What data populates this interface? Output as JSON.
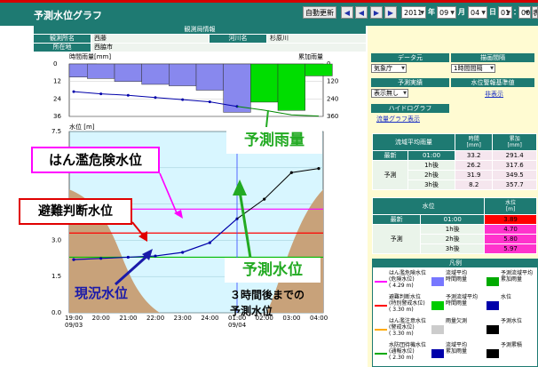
{
  "app_title": "予測水位グラフ",
  "toolbar": {
    "auto_update": "自動更新",
    "year": "2011",
    "year_unit": "年",
    "month": "09",
    "month_unit": "月",
    "day": "04",
    "day_unit": "日",
    "hour": "01",
    "hour_unit": "：",
    "minute": "00",
    "display": "表示"
  },
  "station_info": {
    "header": "観測局情報",
    "station_label": "観測所名",
    "station_value": "西藤",
    "river_label": "河川名",
    "river_value": "杉原川",
    "location_label": "所在地",
    "location_value": "西脇市"
  },
  "side_panel": {
    "data_source_label": "データ元",
    "data_source_value": "気象庁",
    "interval_label": "描画間隔",
    "interval_value": "1時間間隔",
    "forecast_label": "予測実績",
    "forecast_value": "表示無し",
    "warning_label": "水位警報基準値",
    "warning_link": "非表示",
    "hydro_label": "ハイドログラフ",
    "hydro_link": "流量グラフ表示"
  },
  "rain_table": {
    "headers": [
      "流域平均雨量",
      "時間\n[mm]",
      "累加\n[mm]"
    ],
    "rows": [
      {
        "label": "最新",
        "time": "01:00",
        "hourly": "33.2",
        "cumulative": "291.4"
      },
      {
        "label": "予測",
        "time": "1h後",
        "hourly": "26.2",
        "cumulative": "317.6"
      },
      {
        "label": "",
        "time": "2h後",
        "hourly": "31.9",
        "cumulative": "349.5"
      },
      {
        "label": "",
        "time": "3h後",
        "hourly": "8.2",
        "cumulative": "357.7"
      }
    ]
  },
  "level_table": {
    "headers": [
      "水位",
      "水位\n[m]"
    ],
    "rows": [
      {
        "label": "最新",
        "time": "01:00",
        "value": "3.89",
        "color": "#ff0000"
      },
      {
        "label": "予測",
        "time": "1h後",
        "value": "4.70",
        "color": "#ff33cc"
      },
      {
        "label": "",
        "time": "2h後",
        "value": "5.80",
        "color": "#ff33cc"
      },
      {
        "label": "",
        "time": "3h後",
        "value": "5.97",
        "color": "#ff33cc"
      }
    ]
  },
  "legend": {
    "title": "凡例",
    "items": [
      {
        "text": "はん濫危険水位\n(危険水位)\n( 4.29 m)",
        "color": "#ff00ff"
      },
      {
        "text": "流域平均\n時間雨量",
        "color": "#7777ff"
      },
      {
        "text": "予測流域平均\n累加雨量",
        "color": "#00aa00"
      },
      {
        "text": "避難判断水位\n(特別警戒水位)\n( 3.30 m)",
        "color": "#ff0000"
      },
      {
        "text": "予測流域平均\n時間雨量",
        "color": "#00cc00"
      },
      {
        "text": "水位",
        "color": "#0000aa"
      },
      {
        "text": "はん濫注意水位\n(警戒水位)\n( 3.30 m)",
        "color": "#ffaa00"
      },
      {
        "text": "雨量欠測",
        "color": "#cccccc"
      },
      {
        "text": "予測水位",
        "color": "#000000"
      },
      {
        "text": "水防団待機水位\n(通報水位)\n( 2.30 m)",
        "color": "#00aa00"
      },
      {
        "text": "流域平均\n累加雨量",
        "color": "#0000aa"
      },
      {
        "text": "予測累積",
        "color": "#000000"
      }
    ]
  },
  "chart_data": {
    "type": "bar+line",
    "rain": {
      "ylabel_left": "時間雨量[mm]",
      "ylabel_right": "累加雨量",
      "left_ticks": [
        "0",
        "12",
        "24",
        "36"
      ],
      "right_ticks": [
        "0",
        "120",
        "240",
        "360"
      ],
      "hourly_actual": [
        9,
        10,
        12,
        14,
        15,
        18,
        33.2
      ],
      "hourly_forecast": [
        26.2,
        31.9,
        8.2
      ],
      "cumulative_actual": [
        190,
        205,
        215,
        230,
        245,
        260,
        291.4
      ],
      "cumulative_forecast": [
        317.6,
        349.5,
        357.7
      ]
    },
    "level": {
      "ylabel": "水位 [m]",
      "y_ticks": [
        "7.5",
        "6.0",
        "4.5",
        "3.0",
        "1.5",
        "0.0"
      ],
      "ylim": [
        0,
        7.5
      ],
      "x_ticks": [
        "19:00",
        "20:00",
        "21:00",
        "22:00",
        "23:00",
        "24:00",
        "01:00",
        "02:00",
        "03:00",
        "04:00"
      ],
      "date_labels": [
        "09/03",
        "09/04"
      ],
      "actual": [
        2.2,
        2.25,
        2.3,
        2.35,
        2.5,
        2.9,
        3.89
      ],
      "forecast": [
        4.7,
        5.8,
        5.97
      ],
      "thresholds": [
        4.29,
        3.3,
        2.3
      ]
    }
  },
  "annotations": {
    "forecast_rain": "予測雨量",
    "flood_danger": "はん濫危険水位",
    "evacuation": "避難判断水位",
    "forecast_level": "予測水位",
    "forecast_note": "３時間後までの\n予測水位",
    "current_level": "現況水位"
  }
}
